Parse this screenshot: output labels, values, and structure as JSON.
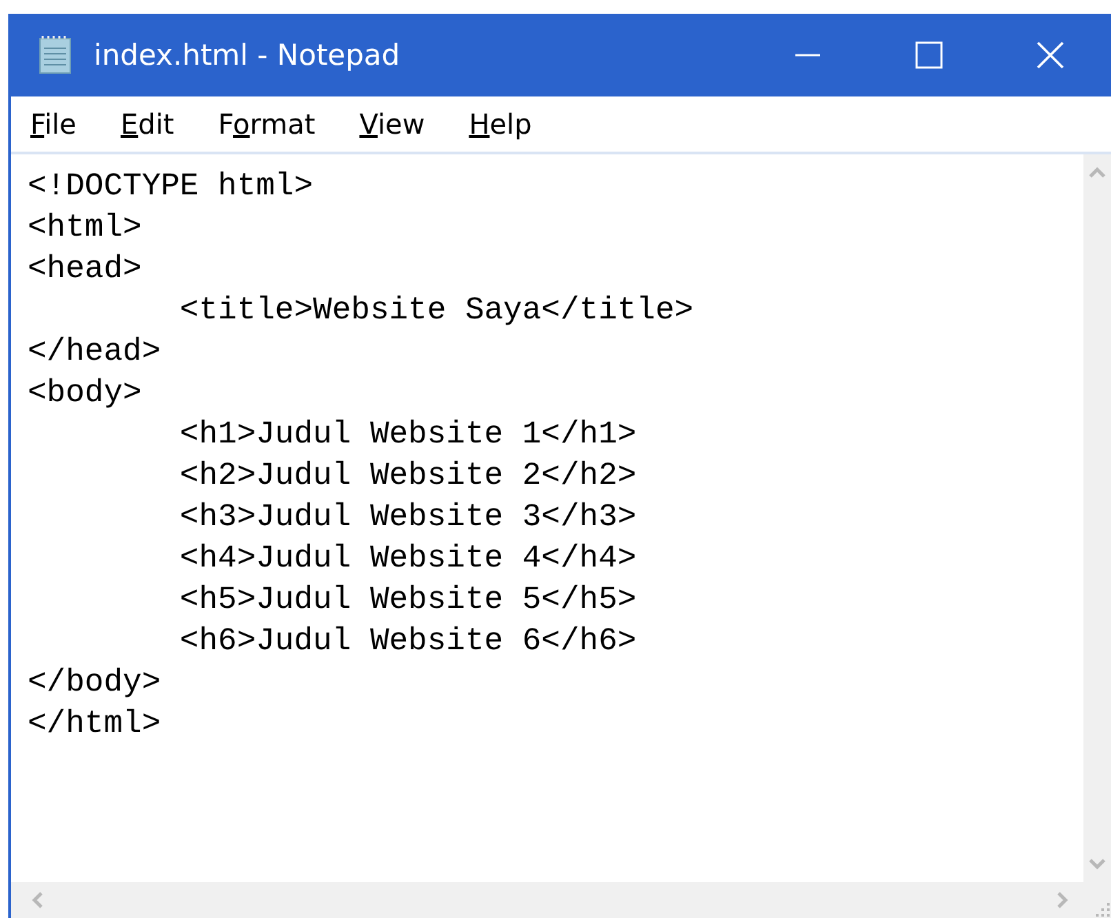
{
  "window": {
    "title": "index.html - Notepad"
  },
  "menu": [
    {
      "mnemonic": "F",
      "after": "ile"
    },
    {
      "mnemonic": "E",
      "after": "dit"
    },
    {
      "before": "F",
      "mnemonic": "o",
      "after": "rmat"
    },
    {
      "mnemonic": "V",
      "after": "iew"
    },
    {
      "mnemonic": "H",
      "after": "elp"
    }
  ],
  "editor": {
    "lines": [
      "<!DOCTYPE html>",
      "<html>",
      "<head>",
      "\t<title>Website Saya</title>",
      "</head>",
      "<body>",
      "\t<h1>Judul Website 1</h1>",
      "\t<h2>Judul Website 2</h2>",
      "\t<h3>Judul Website 3</h3>",
      "\t<h4>Judul Website 4</h4>",
      "\t<h5>Judul Website 5</h5>",
      "\t<h6>Judul Website 6</h6>",
      "</body>",
      "</html>"
    ]
  }
}
